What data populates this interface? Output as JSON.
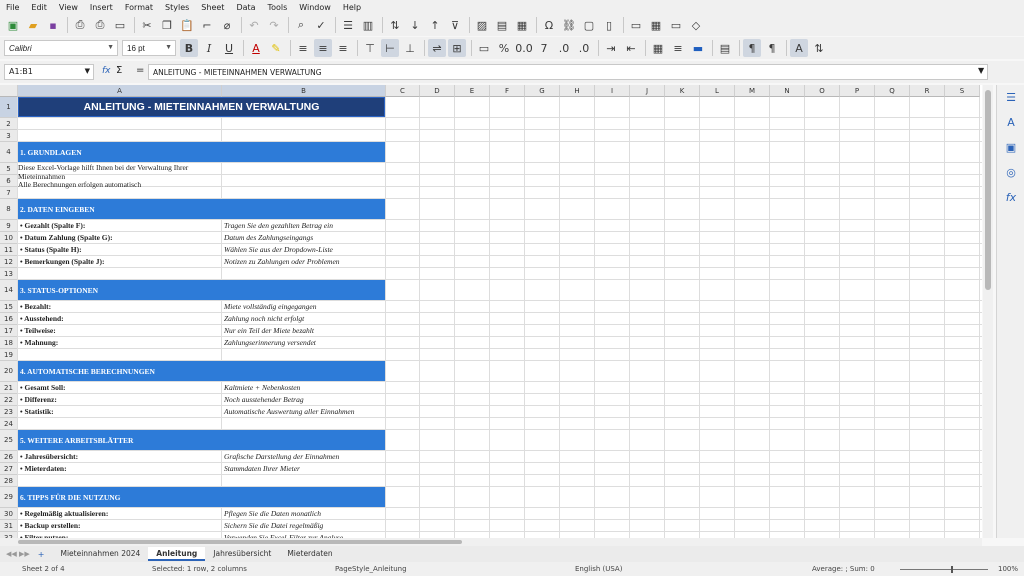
{
  "menu": [
    "File",
    "Edit",
    "View",
    "Insert",
    "Format",
    "Styles",
    "Sheet",
    "Data",
    "Tools",
    "Window",
    "Help"
  ],
  "font": {
    "name": "Calibri",
    "size": "16 pt"
  },
  "formula": {
    "cell_ref": "A1:B1",
    "fx": "fx",
    "sigma": "Σ",
    "eq": "=",
    "content": "ANLEITUNG - MIETEINNAHMEN VERWALTUNG"
  },
  "columns": [
    "A",
    "B",
    "C",
    "D",
    "E",
    "F",
    "G",
    "H",
    "I",
    "J",
    "K",
    "L",
    "M",
    "N",
    "O",
    "P",
    "Q",
    "R",
    "S"
  ],
  "rows": [
    "1",
    "2",
    "3",
    "4",
    "5",
    "6",
    "7",
    "8",
    "9",
    "10",
    "11",
    "12",
    "13",
    "14",
    "15",
    "16",
    "17",
    "18",
    "19",
    "20",
    "21",
    "22",
    "23",
    "24",
    "25",
    "26",
    "27",
    "28",
    "29",
    "30",
    "31",
    "32"
  ],
  "sheet": {
    "title": "ANLEITUNG - MIETEINNAHMEN VERWALTUNG",
    "s1": "1. GRUNDLAGEN",
    "intro1": "Diese Excel-Vorlage hilft Ihnen bei der Verwaltung Ihrer Mieteinnahmen",
    "intro2": "Alle Berechnungen erfolgen automatisch",
    "s2": "2. DATEN EINGEBEN",
    "r9a": "• Gezahlt (Spalte F):",
    "r9b": "Tragen Sie den gezahlten Betrag ein",
    "r10a": "• Datum Zahlung (Spalte G):",
    "r10b": "Datum des Zahlungseingangs",
    "r11a": "• Status (Spalte H):",
    "r11b": "Wählen Sie aus der Dropdown-Liste",
    "r12a": "• Bemerkungen (Spalte J):",
    "r12b": "Notizen zu Zahlungen oder Problemen",
    "s3": "3. STATUS-OPTIONEN",
    "r15a": "• Bezahlt:",
    "r15b": "Miete vollständig eingegangen",
    "r16a": "• Ausstehend:",
    "r16b": "Zahlung noch nicht erfolgt",
    "r17a": "• Teilweise:",
    "r17b": "Nur ein Teil der Miete bezahlt",
    "r18a": "• Mahnung:",
    "r18b": "Zahlungserinnerung versendet",
    "s4": "4. AUTOMATISCHE BERECHNUNGEN",
    "r21a": "• Gesamt Soll:",
    "r21b": "Kaltmiete + Nebenkosten",
    "r22a": "• Differenz:",
    "r22b": "Noch ausstehender Betrag",
    "r23a": "• Statistik:",
    "r23b": "Automatische Auswertung aller Einnahmen",
    "s5": "5. WEITERE ARBEITSBLÄTTER",
    "r26a": "• Jahresübersicht:",
    "r26b": "Grafische Darstellung der Einnahmen",
    "r27a": "• Mieterdaten:",
    "r27b": "Stammdaten Ihrer Mieter",
    "s6": "6. TIPPS FÜR DIE NUTZUNG",
    "r30a": "• Regelmäßig aktualisieren:",
    "r30b": "Pflegen Sie die Daten monatlich",
    "r31a": "• Backup erstellen:",
    "r31b": "Sichern Sie die Datei regelmäßig",
    "r32a": "• Filter nutzen:",
    "r32b": "Verwenden Sie Excel-Filter zur Analyse"
  },
  "tabs": {
    "add": "+",
    "items": [
      "Mieteinnahmen 2024",
      "Anleitung",
      "Jahresübersicht",
      "Mieterdaten"
    ],
    "active": 1
  },
  "status": {
    "sheet": "Sheet 2 of 4",
    "selection": "Selected: 1 row, 2 columns",
    "pagestyle": "PageStyle_Anleitung",
    "lang": "English (USA)",
    "sum": "Average: ; Sum: 0",
    "zoom": "100%"
  }
}
